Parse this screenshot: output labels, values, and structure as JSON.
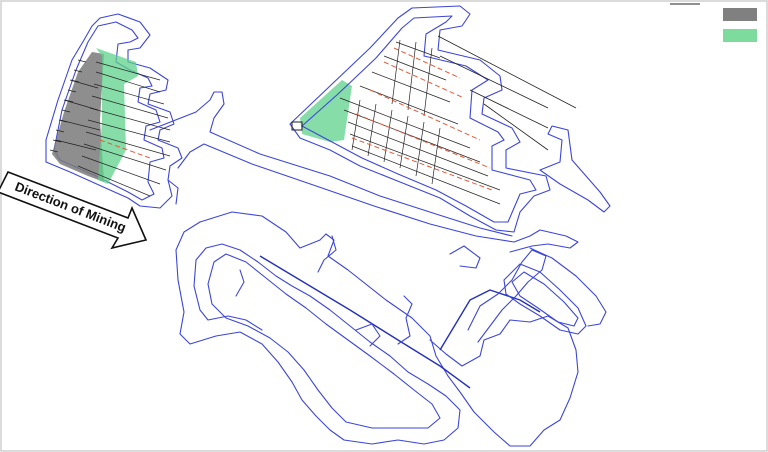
{
  "arrow": {
    "label": "Direction of Mining"
  },
  "legend": {
    "items": [
      {
        "swatch": "#808080"
      },
      {
        "swatch": "#7ddb9e"
      }
    ]
  },
  "colors": {
    "tunnel_outline": "#3c46d8",
    "mined_area": "#7a7a7a",
    "active_area": "#5fd28a",
    "planned_cut": "#e05a3a"
  }
}
